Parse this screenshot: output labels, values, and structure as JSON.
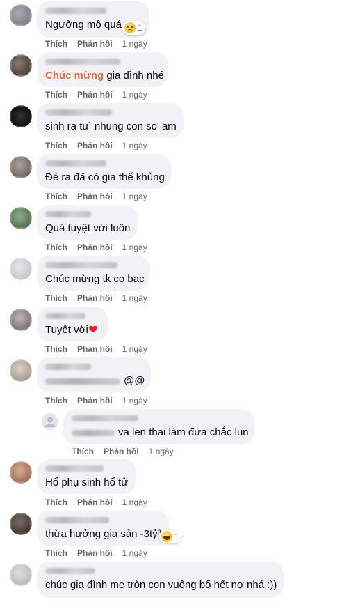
{
  "labels": {
    "like": "Thích",
    "reply": "Phản hồi"
  },
  "comments": [
    {
      "text": "Ngưỡng mộ quá",
      "time": "1 ngày",
      "reaction": {
        "icon": "sad-reaction-icon",
        "count": "1"
      },
      "avatar_color": "#8a8f94"
    },
    {
      "highlight": "Chúc mừng",
      "text": " gia đình nhé",
      "time": "1 ngày",
      "avatar_color": "#6b5a52"
    },
    {
      "text": "sinh ra tu` nhung con so' am",
      "time": "1 ngày",
      "avatar_color": "#1f1f1f"
    },
    {
      "text": "Đẻ ra đã có gia thế khủng",
      "time": "1 ngày",
      "avatar_color": "#8c7f7c"
    },
    {
      "text": "Quá tuyệt vời luôn",
      "time": "1 ngày",
      "avatar_color": "#6f8f6a"
    },
    {
      "text": "Chúc mừng tk co bac",
      "time": "1 ngày",
      "avatar_color": "#d0d2d6"
    },
    {
      "text": "Tuyệt vời",
      "time": "1 ngày",
      "heart": "red-heart-icon",
      "avatar_color": "#9a9090"
    },
    {
      "text": "@@",
      "time": "1 ngày",
      "avatar_color": "#b9b4ad"
    },
    {
      "text": "va len thai làm đứa chắc lun",
      "time": "1 ngày",
      "avatar_color": "#e4e6eb",
      "is_reply": true
    },
    {
      "text": "Hổ phụ sinh hổ tử",
      "time": "1 ngày",
      "avatar_color": "#b7866d"
    },
    {
      "text": "thừa hưởng gia sản -3tỷ³",
      "time": "1 ngày",
      "reaction": {
        "icon": "haha-reaction-icon",
        "count": "1"
      },
      "avatar_color": "#5a5048"
    },
    {
      "text": "chúc gia đình mẹ tròn con vuông bố hết nợ nhá :))",
      "time": "",
      "avatar_color": "#c9c9cc"
    }
  ]
}
